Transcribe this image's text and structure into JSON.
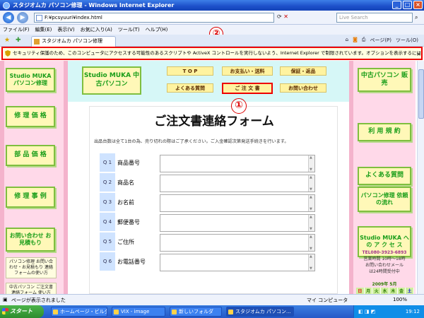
{
  "window": {
    "title": "スタジオムカ パソコン修理 - Windows Internet Explorer"
  },
  "address": {
    "url": "F:¥pcsyuuri¥index.html",
    "search_placeholder": "Live Search"
  },
  "menu": [
    "ファイル(F)",
    "編集(E)",
    "表示(V)",
    "お気に入り(A)",
    "ツール(T)",
    "ヘルプ(H)"
  ],
  "tab": {
    "label": "スタジオムカ パソコン修理"
  },
  "toolbar_right": [
    "ページ(P)",
    "ツール(O)"
  ],
  "security_bar": {
    "text": "セキュリティ保護のため、このコンピュータにアクセスする可能性のあるスクリプトや ActiveX コントロールを実行しないよう、Internet Explorer で制限されています。オプションを表示するには、ここをクリックしてください..."
  },
  "annotations": {
    "one": "①",
    "two": "②"
  },
  "site": {
    "left_nav": [
      "Studio MUKA パソコン修理",
      "修 理 価 格",
      "部 品 価 格",
      "修 理 事 例",
      "お問い合わせ お見積もり"
    ],
    "left_text": [
      "パソコン修理 お問い合わせ・お見積もり 連絡フォームの使い方",
      "中古パソコン ご注文書 連絡フォーム 使い方"
    ],
    "logo": "Studio MUKA 中古パソコン",
    "top_nav": [
      "T O P",
      "お支払い・送料",
      "保証・返品",
      "よくある質問",
      "ご 注 文 書",
      "お問い合わせ"
    ],
    "right_nav": [
      "中古パソコン 販 売",
      "利 用 規 約",
      "よくある質問",
      "パソコン修理 依頼の流れ",
      "Studio MUKA への ア ク セ ス"
    ],
    "right_info": [
      "TEL080-3923-6893",
      "営業時間 10時〜18時",
      "お問い合わせメール",
      "は24時間受付中"
    ],
    "calendar": {
      "month": "2009年 5月",
      "days": [
        "日",
        "月",
        "火",
        "水",
        "木",
        "金",
        "土"
      ]
    },
    "form_title": "ご注文書連絡フォーム",
    "form_note": "出品台数は全て1台の為、売り切れの際はご了承ください。ご入金確認次第発送手続きを行います。",
    "questions": [
      {
        "no": "Q 1",
        "label": "商品番号"
      },
      {
        "no": "Q 2",
        "label": "商品名"
      },
      {
        "no": "Q 3",
        "label": "お名前"
      },
      {
        "no": "Q 4",
        "label": "郵便番号"
      },
      {
        "no": "Q 5",
        "label": "ご住所"
      },
      {
        "no": "Q 6",
        "label": "お電話番号"
      }
    ]
  },
  "status": {
    "text": "ページが表示されました",
    "zone": "マイ コンピュータ",
    "zoom": "100%"
  },
  "taskbar": {
    "start": "スタート",
    "buttons": [
      "ホームページ・ビルダ...",
      "VIX - image",
      "新しいフォルダ",
      "スタジオムカ パソコン..."
    ],
    "time": "19:12"
  }
}
